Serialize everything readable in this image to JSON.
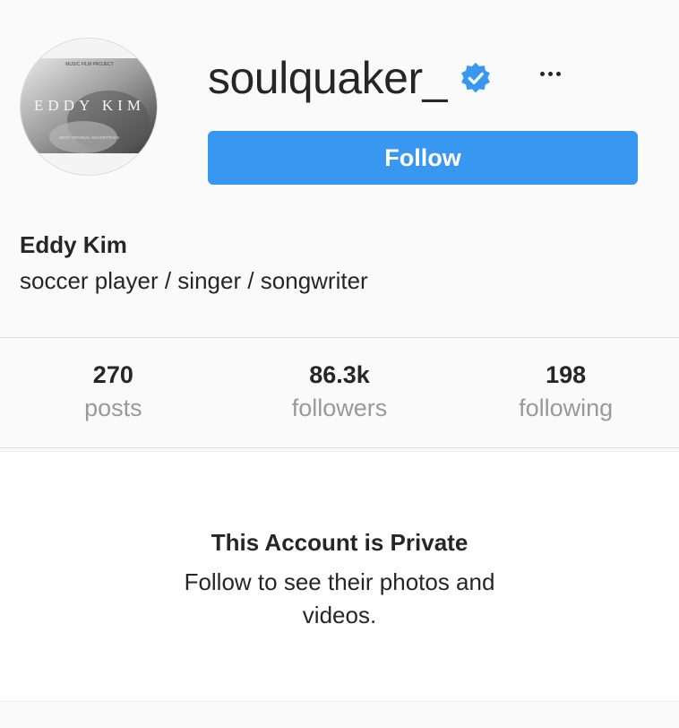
{
  "profile": {
    "username": "soulquaker_",
    "verified": true,
    "full_name": "Eddy Kim",
    "bio": "soccer player / singer / songwriter",
    "avatar_text": "EDDY KIM",
    "avatar_caption_top": "MUSIC FILM PROJECT",
    "avatar_caption_bottom": "BEST ORIGINAL SOUNDTRACK"
  },
  "actions": {
    "follow_label": "Follow"
  },
  "stats": [
    {
      "value": "270",
      "label": "posts"
    },
    {
      "value": "86.3k",
      "label": "followers"
    },
    {
      "value": "198",
      "label": "following"
    }
  ],
  "private_notice": {
    "title": "This Account is Private",
    "subtitle": "Follow to see their photos and videos."
  },
  "colors": {
    "accent": "#3897f0",
    "background": "#fafafa",
    "muted_text": "#999999"
  },
  "icons": {
    "verified": "verified-badge-icon",
    "more": "more-options-icon"
  }
}
